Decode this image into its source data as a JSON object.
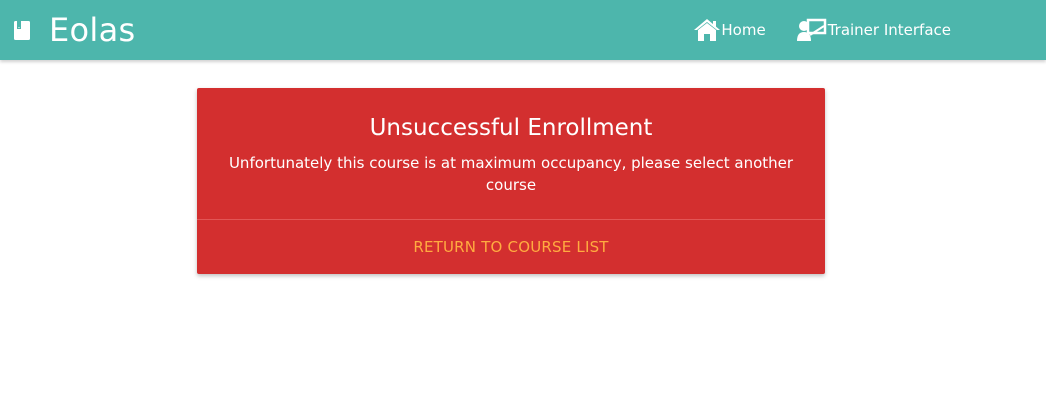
{
  "navbar": {
    "brand_icon": "book-icon",
    "brand_title": "Eolas",
    "background_color": "#4db6ac",
    "links": [
      {
        "icon": "home-icon",
        "label": "Home"
      },
      {
        "icon": "trainer-icon",
        "label": "Trainer Interface"
      }
    ]
  },
  "card": {
    "background_color": "#d32f2f",
    "title": "Unsuccessful Enrollment",
    "message": "Unfortunately this course is at maximum occupancy, please select another course",
    "action_label": "Return to course list",
    "action_color": "#ffab40"
  }
}
